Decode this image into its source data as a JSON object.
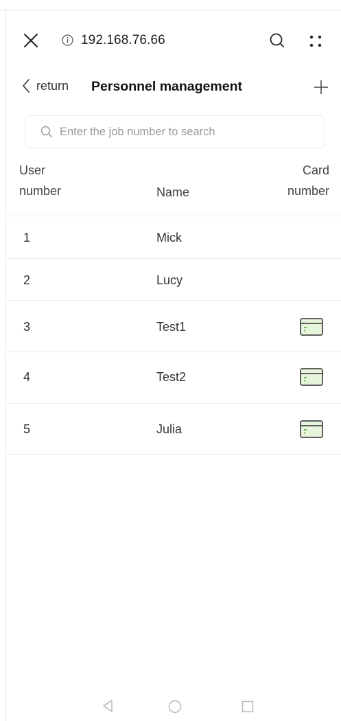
{
  "browser": {
    "url": "192.168.76.66"
  },
  "header": {
    "back_label": "return",
    "title": "Personnel management"
  },
  "search": {
    "placeholder": "Enter the job number to search"
  },
  "table": {
    "columns": {
      "user_number_line1": "User",
      "user_number_line2": "number",
      "name": "Name",
      "card_number_line1": "Card",
      "card_number_line2": "number"
    },
    "rows": [
      {
        "number": "1",
        "name": "Mick",
        "has_card": false
      },
      {
        "number": "2",
        "name": "Lucy",
        "has_card": false
      },
      {
        "number": "3",
        "name": "Test1",
        "has_card": true
      },
      {
        "number": "4",
        "name": "Test2",
        "has_card": true
      },
      {
        "number": "5",
        "name": "Julia",
        "has_card": true
      }
    ]
  },
  "icons": {
    "close": "close-icon",
    "info": "info-icon",
    "search": "search-icon",
    "more": "more-icon",
    "back": "chevron-left-icon",
    "add": "plus-icon",
    "card": "card-icon"
  },
  "colors": {
    "card_accent": "#6ab04c",
    "card_fill": "#e8f5dd",
    "card_outline": "#4a4a4a"
  }
}
